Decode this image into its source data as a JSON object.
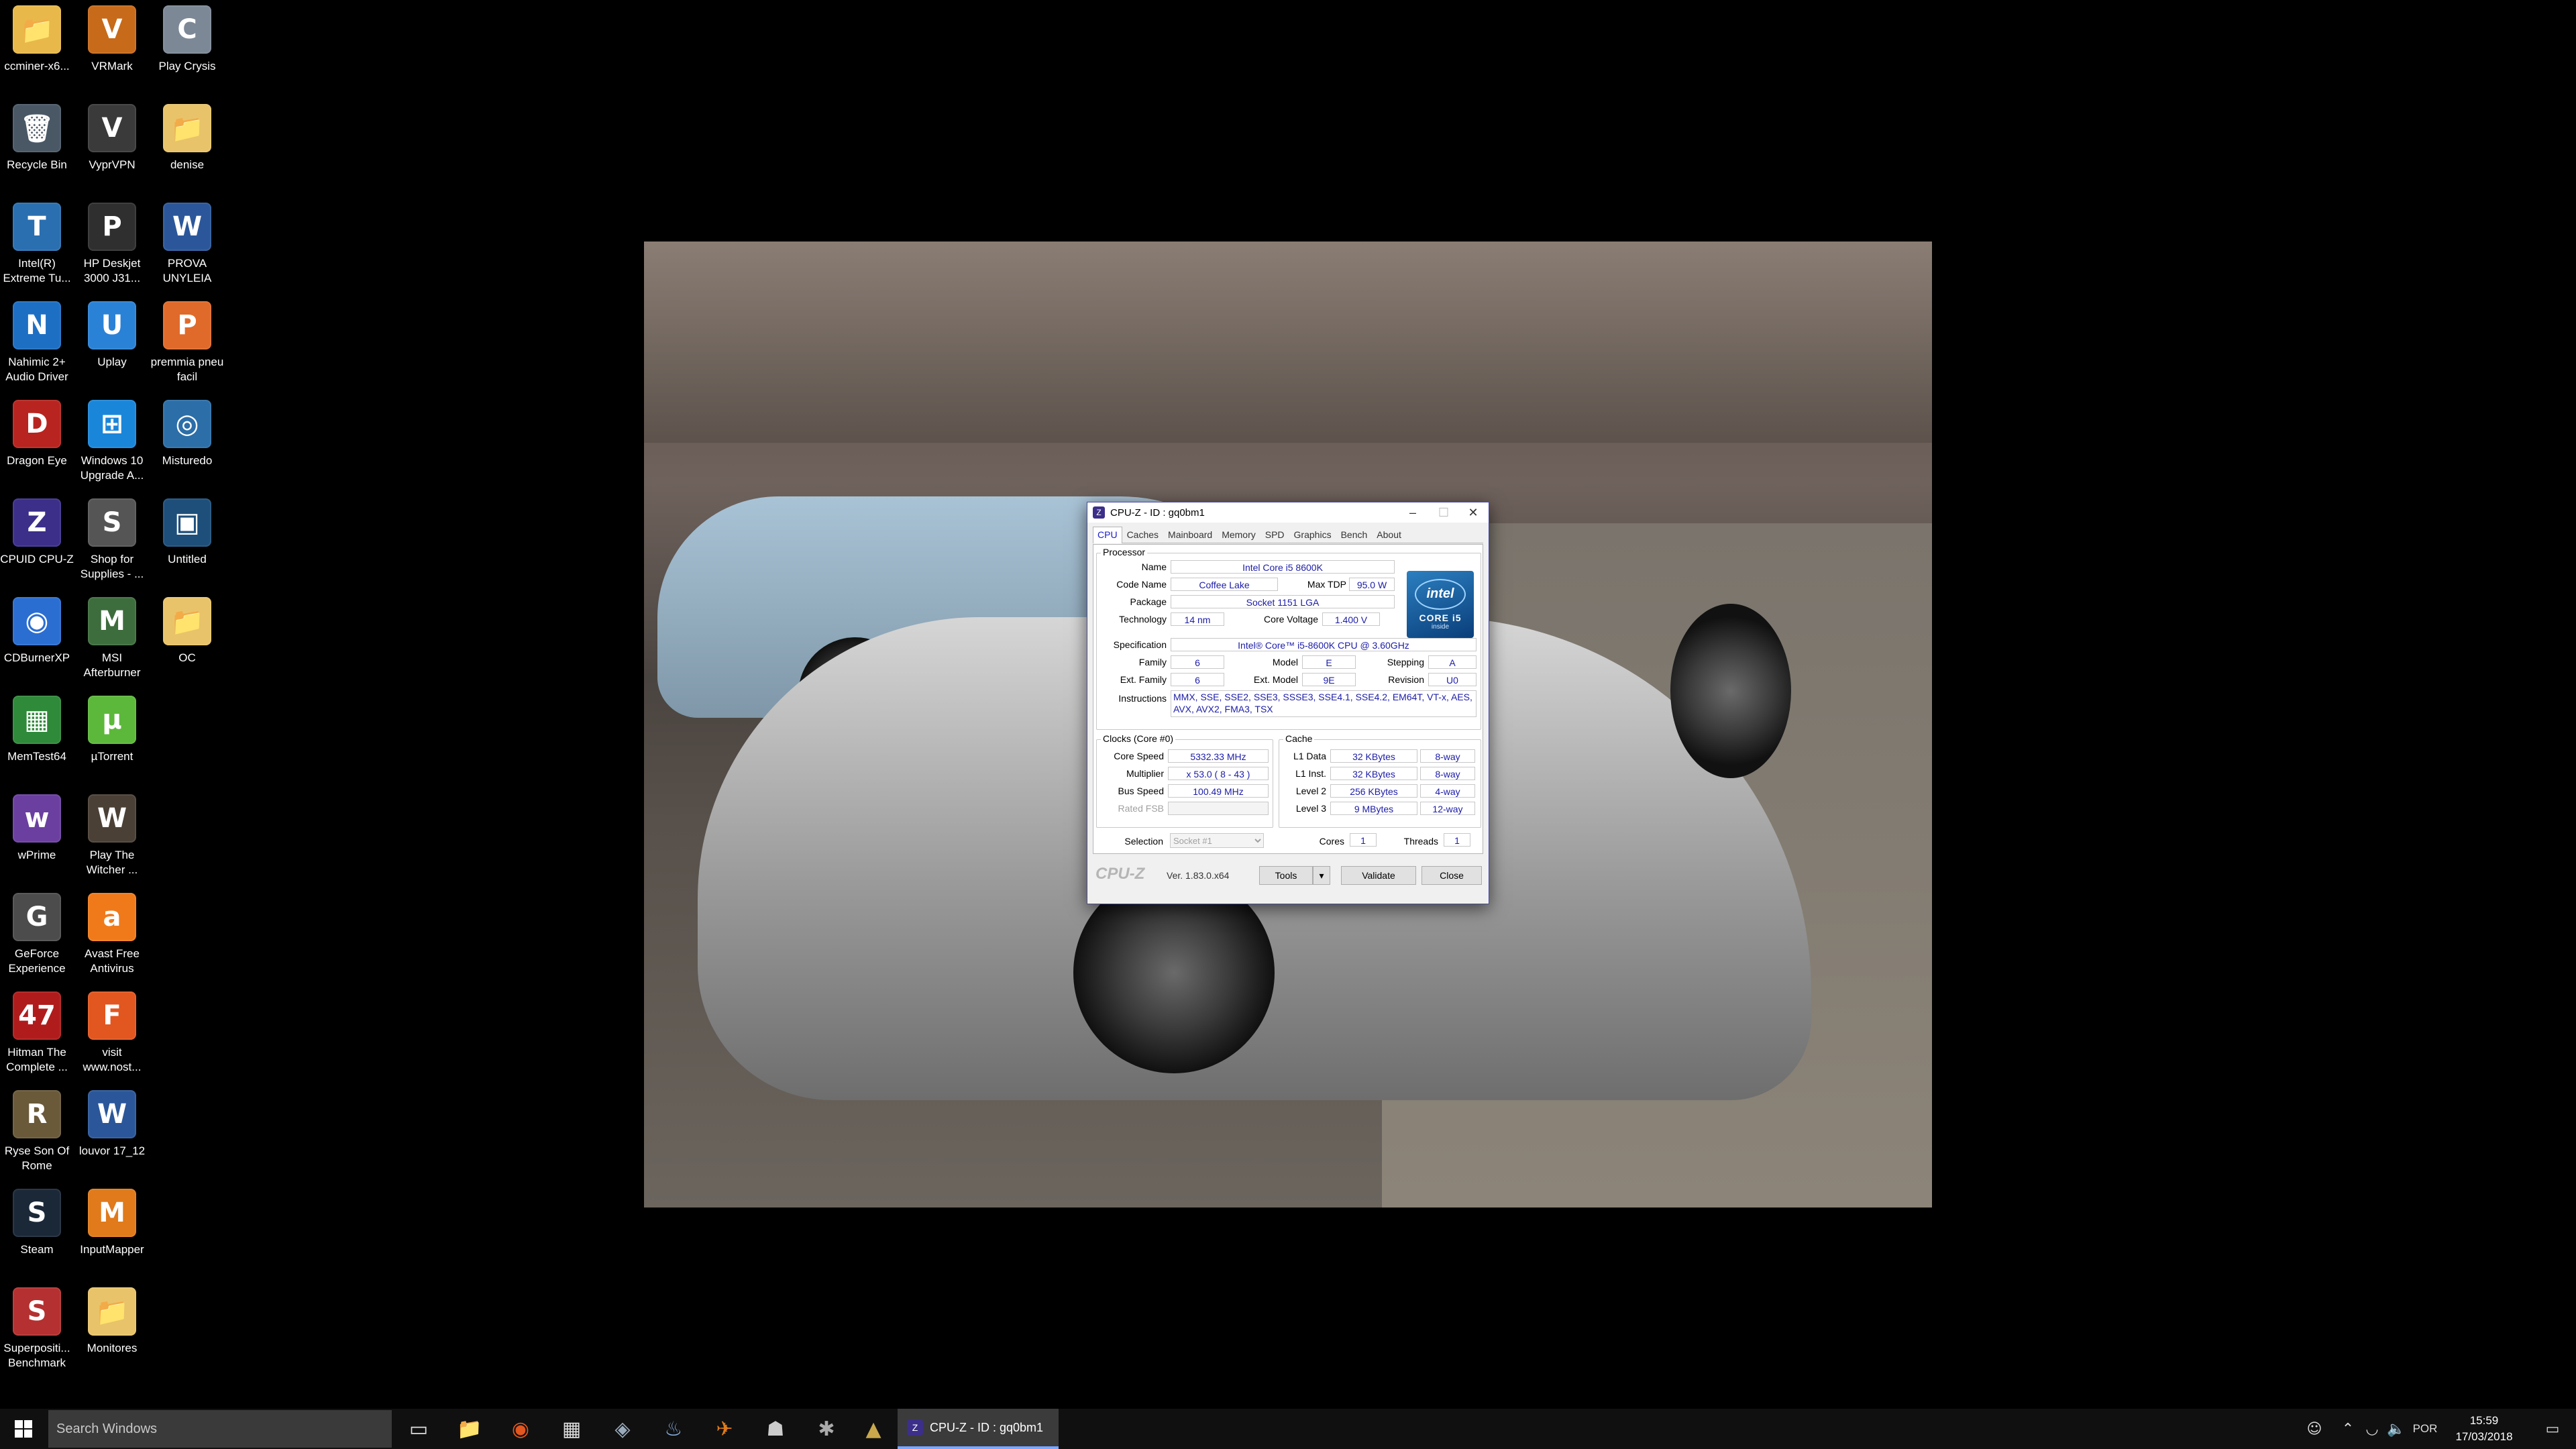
{
  "desktop": {
    "icons": [
      {
        "label": "ccminer-x6...",
        "glyph": "📁",
        "color": "#e8b84a"
      },
      {
        "label": "VRMark",
        "glyph": "V",
        "color": "#c76a1a"
      },
      {
        "label": "Play Crysis",
        "glyph": "C",
        "color": "#7d8896"
      },
      {
        "label": "Recycle Bin",
        "glyph": "🗑",
        "color": "#4a5866"
      },
      {
        "label": "VyprVPN",
        "glyph": "V",
        "color": "#3a3a3a"
      },
      {
        "label": "denise",
        "glyph": "📁",
        "color": "#e8c36a"
      },
      {
        "label": "Intel(R) Extreme Tu...",
        "glyph": "T",
        "color": "#2a6fb0"
      },
      {
        "label": "HP Deskjet 3000 J31...",
        "glyph": "P",
        "color": "#2f2f2f"
      },
      {
        "label": "PROVA UNYLEIA",
        "glyph": "W",
        "color": "#2b579a"
      },
      {
        "label": "Nahimic 2+ Audio Driver",
        "glyph": "N",
        "color": "#1d6fc4"
      },
      {
        "label": "Uplay",
        "glyph": "U",
        "color": "#2a82d6"
      },
      {
        "label": "premmia pneu facil",
        "glyph": "P",
        "color": "#e06a2a"
      },
      {
        "label": "Dragon Eye",
        "glyph": "D",
        "color": "#b8241f"
      },
      {
        "label": "Windows 10 Upgrade A...",
        "glyph": "⊞",
        "color": "#1a86d9"
      },
      {
        "label": "Misturedo",
        "glyph": "◎",
        "color": "#2c6ea8"
      },
      {
        "label": "CPUID CPU-Z",
        "glyph": "Z",
        "color": "#3b2f8a"
      },
      {
        "label": "Shop for Supplies - ...",
        "glyph": "S",
        "color": "#555"
      },
      {
        "label": "Untitled",
        "glyph": "▣",
        "color": "#1e4f7a"
      },
      {
        "label": "CDBurnerXP",
        "glyph": "◉",
        "color": "#2b6ed1"
      },
      {
        "label": "MSI Afterburner",
        "glyph": "M",
        "color": "#3d6d3d"
      },
      {
        "label": "OC",
        "glyph": "📁",
        "color": "#e8c36a"
      },
      {
        "label": "MemTest64",
        "glyph": "▦",
        "color": "#2f8a3a"
      },
      {
        "label": "µTorrent",
        "glyph": "µ",
        "color": "#5cb83a"
      },
      {
        "label": "wPrime",
        "glyph": "w",
        "color": "#6b3fa0"
      },
      {
        "label": "Play The Witcher ...",
        "glyph": "W",
        "color": "#4a4036"
      },
      {
        "label": "GeForce Experience",
        "glyph": "G",
        "color": "#4c4c4c"
      },
      {
        "label": "Avast Free Antivirus",
        "glyph": "a",
        "color": "#f07a1a"
      },
      {
        "label": "Hitman The Complete ...",
        "glyph": "47",
        "color": "#b01c1c"
      },
      {
        "label": "visit www.nost...",
        "glyph": "F",
        "color": "#e2561f"
      },
      {
        "label": "Ryse Son Of Rome",
        "glyph": "R",
        "color": "#6a5a3a"
      },
      {
        "label": "louvor 17_12",
        "glyph": "W",
        "color": "#2b579a"
      },
      {
        "label": "Steam",
        "glyph": "S",
        "color": "#1b2838"
      },
      {
        "label": "InputMapper",
        "glyph": "M",
        "color": "#e07a1a"
      },
      {
        "label": "Superpositi... Benchmark",
        "glyph": "S",
        "color": "#b53030"
      },
      {
        "label": "Monitores",
        "glyph": "📁",
        "color": "#e8c36a"
      }
    ]
  },
  "cpuz": {
    "title": "CPU-Z - ID : gq0bm1",
    "tabs": [
      "CPU",
      "Caches",
      "Mainboard",
      "Memory",
      "SPD",
      "Graphics",
      "Bench",
      "About"
    ],
    "active_tab": "CPU",
    "processor": {
      "group_title": "Processor",
      "name_label": "Name",
      "name": "Intel Core i5 8600K",
      "codename_label": "Code Name",
      "codename": "Coffee Lake",
      "maxtdp_label": "Max TDP",
      "maxtdp": "95.0 W",
      "package_label": "Package",
      "package": "Socket 1151 LGA",
      "technology_label": "Technology",
      "technology": "14 nm",
      "corevoltage_label": "Core Voltage",
      "corevoltage": "1.400 V",
      "spec_label": "Specification",
      "spec": "Intel® Core™ i5-8600K CPU @ 3.60GHz",
      "family_label": "Family",
      "family": "6",
      "model_label": "Model",
      "model": "E",
      "stepping_label": "Stepping",
      "stepping": "A",
      "extfamily_label": "Ext. Family",
      "extfamily": "6",
      "extmodel_label": "Ext. Model",
      "extmodel": "9E",
      "revision_label": "Revision",
      "revision": "U0",
      "instructions_label": "Instructions",
      "instructions": "MMX, SSE, SSE2, SSE3, SSSE3, SSE4.1, SSE4.2, EM64T, VT-x, AES, AVX, AVX2, FMA3, TSX",
      "logo_brand": "intel",
      "logo_line": "CORE i5",
      "logo_sub": "inside"
    },
    "clocks": {
      "group_title": "Clocks (Core #0)",
      "corespeed_label": "Core Speed",
      "corespeed": "5332.33 MHz",
      "multiplier_label": "Multiplier",
      "multiplier": "x 53.0 ( 8 - 43 )",
      "busspeed_label": "Bus Speed",
      "busspeed": "100.49 MHz",
      "ratedfsb_label": "Rated FSB",
      "ratedfsb": ""
    },
    "cache": {
      "group_title": "Cache",
      "l1d_label": "L1 Data",
      "l1d": "32 KBytes",
      "l1d_way": "8-way",
      "l1i_label": "L1 Inst.",
      "l1i": "32 KBytes",
      "l1i_way": "8-way",
      "l2_label": "Level 2",
      "l2": "256 KBytes",
      "l2_way": "4-way",
      "l3_label": "Level 3",
      "l3": "9 MBytes",
      "l3_way": "12-way"
    },
    "selection_label": "Selection",
    "selection_value": "Socket #1",
    "cores_label": "Cores",
    "cores": "1",
    "threads_label": "Threads",
    "threads": "1",
    "brand": "CPU-Z",
    "version": "Ver. 1.83.0.x64",
    "tools_label": "Tools",
    "validate_label": "Validate",
    "close_label": "Close"
  },
  "taskbar": {
    "search_placeholder": "Search Windows",
    "active_window": "CPU-Z - ID : gq0bm1",
    "language": "POR",
    "time": "15:59",
    "date": "17/03/2018"
  }
}
